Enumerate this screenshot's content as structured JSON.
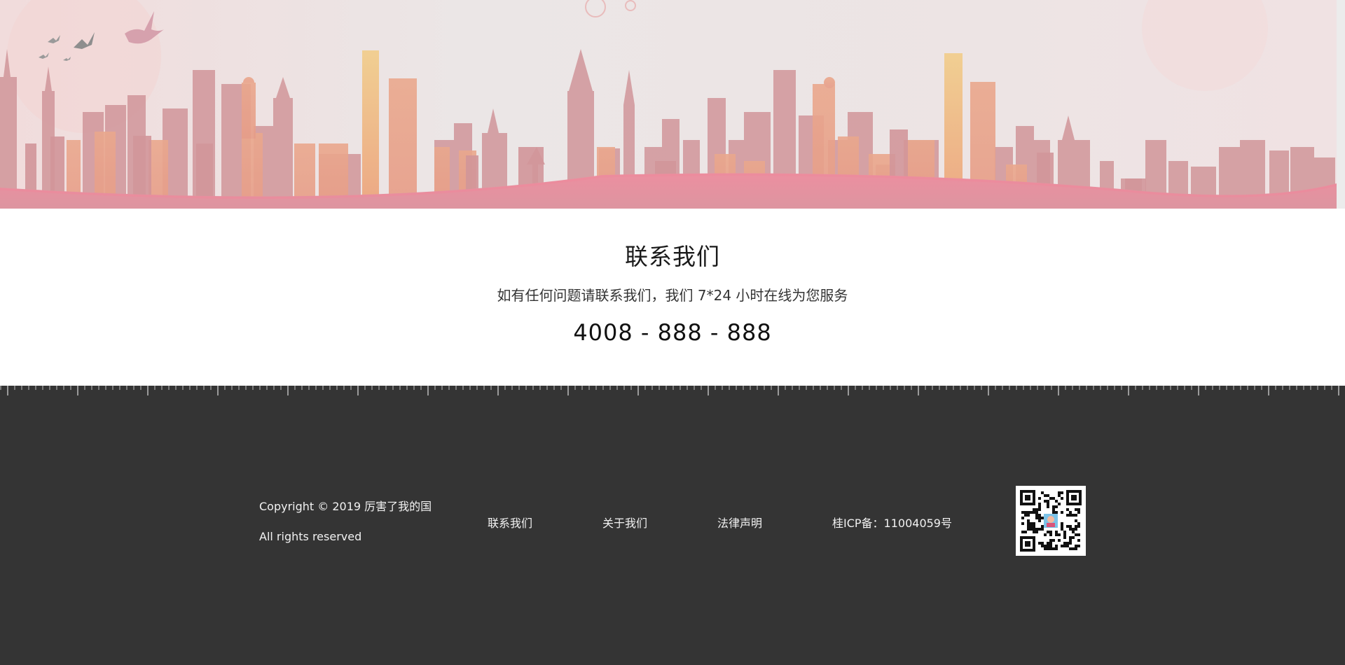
{
  "contact": {
    "title": "联系我们",
    "subtitle": "如有任何问题请联系我们，我们 7*24 小时在线为您服务",
    "phone": "4008 - 888 - 888"
  },
  "footer": {
    "copyright": "Copyright © 2019 厉害了我的国",
    "rights": "All rights reserved",
    "links": [
      "联系我们",
      "关于我们",
      "法律声明"
    ],
    "icp": "桂ICP备：11004059号"
  },
  "colors": {
    "footer_bg": "#343434",
    "banner_sky": "#ece7e8",
    "skyline_pink": "#d28e94",
    "skyline_orange": "#eeb28a",
    "wave_pink": "#e88d9c"
  },
  "icons": {
    "birds": "flying-birds-icon",
    "qr": "qr-code-icon"
  }
}
